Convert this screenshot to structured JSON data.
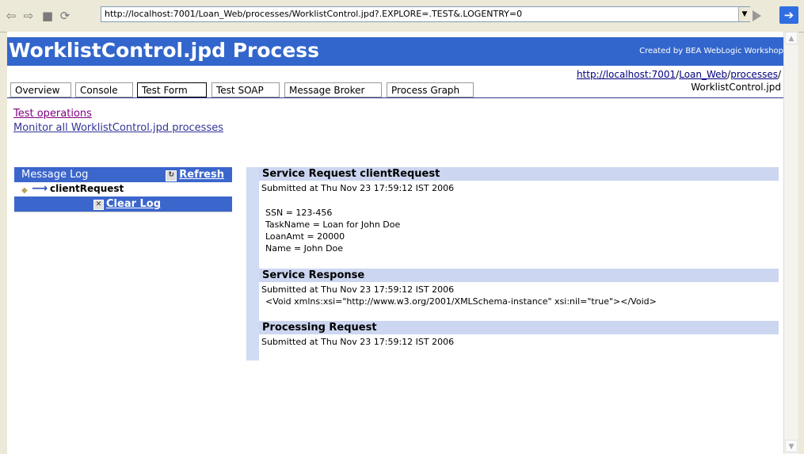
{
  "browser": {
    "address": "http://localhost:7001/Loan_Web/processes/WorklistControl.jpd?.EXPLORE=.TEST&.LOGENTRY=0"
  },
  "header": {
    "title": "WorklistControl.jpd Process",
    "credit": "Created by BEA WebLogic Workshop"
  },
  "url_path": {
    "host": "http://localhost:7001",
    "sep1": "/",
    "app": "Loan_Web",
    "sep2": "/",
    "folder": "processes",
    "sep3": "/",
    "file": "WorklistControl.jpd"
  },
  "tabs": [
    "Overview",
    "Console",
    "Test Form",
    "Test SOAP",
    "Message Broker",
    "Process Graph"
  ],
  "active_tab": "Test Form",
  "links": {
    "test_operations": "Test operations",
    "monitor": "Monitor all WorklistControl.jpd processes"
  },
  "message_log": {
    "title": "Message Log",
    "refresh": "Refresh",
    "item": "clientRequest",
    "clear": "Clear Log"
  },
  "sections": [
    {
      "title": "Service Request clientRequest",
      "submitted": "Submitted at Thu Nov 23 17:59:12 IST 2006",
      "body": [
        "SSN = 123-456",
        "TaskName = Loan for John Doe",
        "LoanAmt = 20000",
        "Name = John Doe"
      ]
    },
    {
      "title": "Service Response",
      "submitted": "Submitted at Thu Nov 23 17:59:12 IST 2006",
      "body": [
        "<Void xmlns:xsi=\"http://www.w3.org/2001/XMLSchema-instance\" xsi:nil=\"true\"></Void>"
      ]
    },
    {
      "title": "Processing Request",
      "submitted": "Submitted at Thu Nov 23 17:59:12 IST 2006",
      "body": []
    }
  ],
  "colors": {
    "header_blue": "#3366cc",
    "section_band": "#ccd6f0",
    "link": "#333399",
    "visited": "#800080"
  }
}
